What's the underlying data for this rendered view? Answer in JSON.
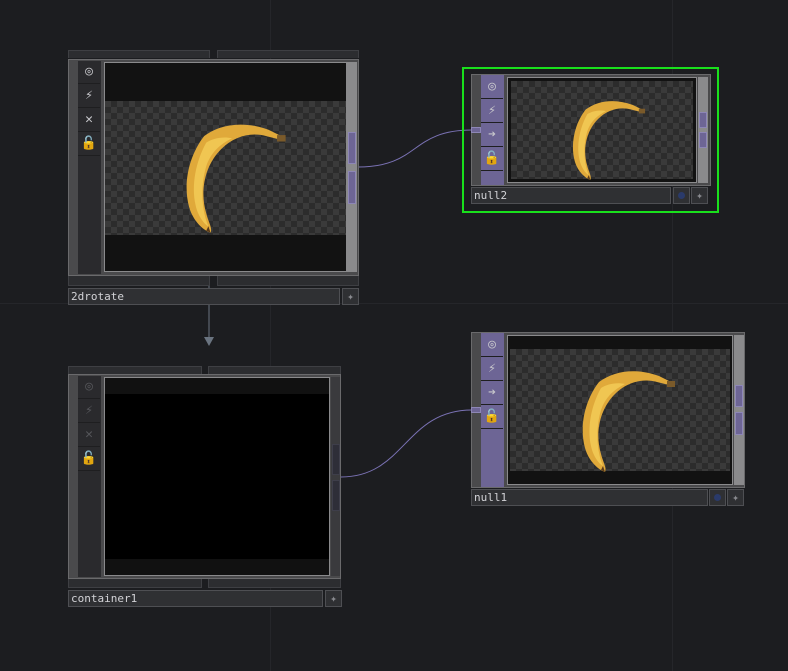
{
  "nodes": {
    "rotate": {
      "name": "2drotate"
    },
    "null2": {
      "name": "null2"
    },
    "container": {
      "name": "container1"
    },
    "null1": {
      "name": "null1"
    }
  },
  "buttons": {
    "viewer": "◎",
    "bypass": "⚡",
    "clone": "✕",
    "display": "➔",
    "lock": "🔓",
    "add": "✦"
  },
  "colors": {
    "background": "#1c1d20",
    "selection": "#19e01c",
    "wire": "#7a72b4",
    "node_accent": "#6d6595"
  }
}
